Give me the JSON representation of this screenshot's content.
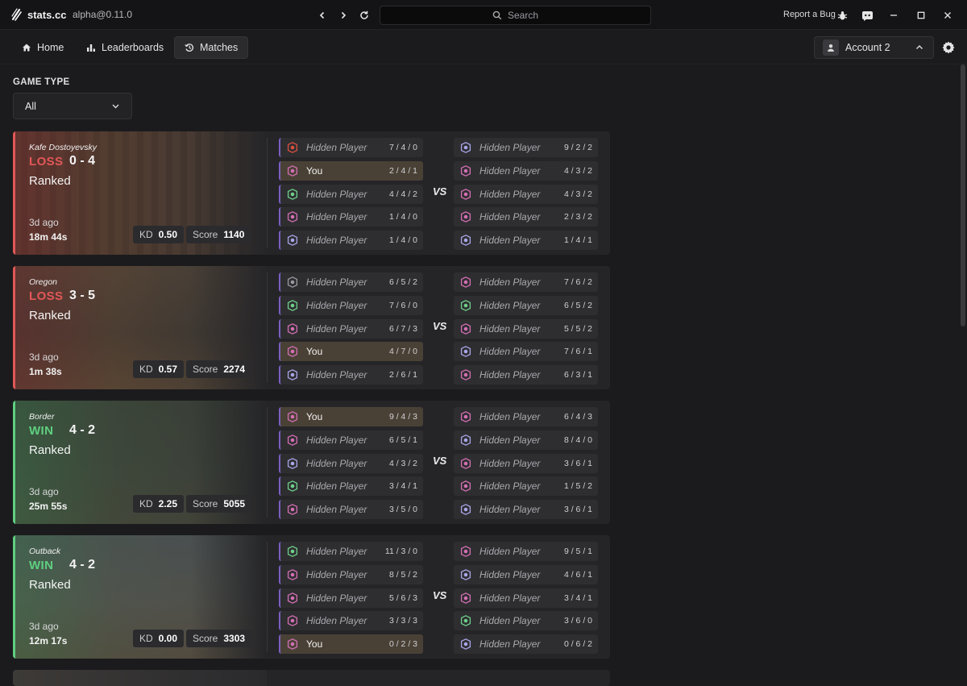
{
  "app": {
    "name": "stats.cc",
    "version": "alpha@0.11.0",
    "search_placeholder": "Search",
    "report_bug": "Report a Bug"
  },
  "nav": {
    "home": "Home",
    "leaderboards": "Leaderboards",
    "matches": "Matches",
    "active": "Matches",
    "account": "Account 2"
  },
  "filter": {
    "label": "GAME TYPE",
    "value": "All"
  },
  "colors": {
    "win": "#5fcf80",
    "loss": "#e25757",
    "you_row": "#4a4136",
    "team_accent": "#7a5fc0"
  },
  "vs_label": "VS",
  "matches": [
    {
      "map": "Kafe Dostoyevsky",
      "result": "LOSS",
      "score": "0 - 4",
      "mode": "Ranked",
      "ago": "3d ago",
      "duration": "18m 44s",
      "kd_label": "KD",
      "kd": "0.50",
      "score_label": "Score",
      "points": "1140",
      "team": [
        {
          "name": "Hidden Player",
          "stats": "7 / 4 / 0",
          "icon": "red-operator-icon"
        },
        {
          "name": "You",
          "stats": "2 / 4 / 1",
          "icon": "pink-operator-icon"
        },
        {
          "name": "Hidden Player",
          "stats": "4 / 4 / 2",
          "icon": "green-operator-icon"
        },
        {
          "name": "Hidden Player",
          "stats": "1 / 4 / 0",
          "icon": "pink-operator-icon"
        },
        {
          "name": "Hidden Player",
          "stats": "1 / 4 / 0",
          "icon": "lavender-operator-icon"
        }
      ],
      "enemies": [
        {
          "name": "Hidden Player",
          "stats": "9 / 2 / 2",
          "icon": "lavender-operator-icon"
        },
        {
          "name": "Hidden Player",
          "stats": "4 / 3 / 2",
          "icon": "pink-operator-icon"
        },
        {
          "name": "Hidden Player",
          "stats": "4 / 3 / 2",
          "icon": "pink-operator-icon"
        },
        {
          "name": "Hidden Player",
          "stats": "2 / 3 / 2",
          "icon": "pink-operator-icon"
        },
        {
          "name": "Hidden Player",
          "stats": "1 / 4 / 1",
          "icon": "lavender-operator-icon"
        }
      ]
    },
    {
      "map": "Oregon",
      "result": "LOSS",
      "score": "3 - 5",
      "mode": "Ranked",
      "ago": "3d ago",
      "duration": "1m 38s",
      "kd_label": "KD",
      "kd": "0.57",
      "score_label": "Score",
      "points": "2274",
      "team": [
        {
          "name": "Hidden Player",
          "stats": "6 / 5 / 2",
          "icon": "grey-operator-icon"
        },
        {
          "name": "Hidden Player",
          "stats": "7 / 6 / 0",
          "icon": "green-operator-icon"
        },
        {
          "name": "Hidden Player",
          "stats": "6 / 7 / 3",
          "icon": "pink-operator-icon"
        },
        {
          "name": "You",
          "stats": "4 / 7 / 0",
          "icon": "pink-operator-icon"
        },
        {
          "name": "Hidden Player",
          "stats": "2 / 6 / 1",
          "icon": "lavender-operator-icon"
        }
      ],
      "enemies": [
        {
          "name": "Hidden Player",
          "stats": "7 / 6 / 2",
          "icon": "pink-operator-icon"
        },
        {
          "name": "Hidden Player",
          "stats": "6 / 5 / 2",
          "icon": "green-operator-icon"
        },
        {
          "name": "Hidden Player",
          "stats": "5 / 5 / 2",
          "icon": "pink-operator-icon"
        },
        {
          "name": "Hidden Player",
          "stats": "7 / 6 / 1",
          "icon": "lavender-operator-icon"
        },
        {
          "name": "Hidden Player",
          "stats": "6 / 3 / 1",
          "icon": "pink-operator-icon"
        }
      ]
    },
    {
      "map": "Border",
      "result": "WIN",
      "score": "4 - 2",
      "mode": "Ranked",
      "ago": "3d ago",
      "duration": "25m 55s",
      "kd_label": "KD",
      "kd": "2.25",
      "score_label": "Score",
      "points": "5055",
      "team": [
        {
          "name": "You",
          "stats": "9 / 4 / 3",
          "icon": "pink-operator-icon"
        },
        {
          "name": "Hidden Player",
          "stats": "6 / 5 / 1",
          "icon": "pink-operator-icon"
        },
        {
          "name": "Hidden Player",
          "stats": "4 / 3 / 2",
          "icon": "lavender-operator-icon"
        },
        {
          "name": "Hidden Player",
          "stats": "3 / 4 / 1",
          "icon": "green-operator-icon"
        },
        {
          "name": "Hidden Player",
          "stats": "3 / 5 / 0",
          "icon": "pink-operator-icon"
        }
      ],
      "enemies": [
        {
          "name": "Hidden Player",
          "stats": "6 / 4 / 3",
          "icon": "pink-operator-icon"
        },
        {
          "name": "Hidden Player",
          "stats": "8 / 4 / 0",
          "icon": "lavender-operator-icon"
        },
        {
          "name": "Hidden Player",
          "stats": "3 / 6 / 1",
          "icon": "pink-operator-icon"
        },
        {
          "name": "Hidden Player",
          "stats": "1 / 5 / 2",
          "icon": "pink-operator-icon"
        },
        {
          "name": "Hidden Player",
          "stats": "3 / 6 / 1",
          "icon": "lavender-operator-icon"
        }
      ]
    },
    {
      "map": "Outback",
      "result": "WIN",
      "score": "4 - 2",
      "mode": "Ranked",
      "ago": "3d ago",
      "duration": "12m 17s",
      "kd_label": "KD",
      "kd": "0.00",
      "score_label": "Score",
      "points": "3303",
      "team": [
        {
          "name": "Hidden Player",
          "stats": "11 / 3 / 0",
          "icon": "green-operator-icon"
        },
        {
          "name": "Hidden Player",
          "stats": "8 / 5 / 2",
          "icon": "pink-operator-icon"
        },
        {
          "name": "Hidden Player",
          "stats": "5 / 6 / 3",
          "icon": "pink-operator-icon"
        },
        {
          "name": "Hidden Player",
          "stats": "3 / 3 / 3",
          "icon": "pink-operator-icon"
        },
        {
          "name": "You",
          "stats": "0 / 2 / 3",
          "icon": "pink-operator-icon"
        }
      ],
      "enemies": [
        {
          "name": "Hidden Player",
          "stats": "9 / 5 / 1",
          "icon": "pink-operator-icon"
        },
        {
          "name": "Hidden Player",
          "stats": "4 / 6 / 1",
          "icon": "lavender-operator-icon"
        },
        {
          "name": "Hidden Player",
          "stats": "3 / 4 / 1",
          "icon": "pink-operator-icon"
        },
        {
          "name": "Hidden Player",
          "stats": "3 / 6 / 0",
          "icon": "green-operator-icon"
        },
        {
          "name": "Hidden Player",
          "stats": "0 / 6 / 2",
          "icon": "lavender-operator-icon"
        }
      ]
    }
  ]
}
